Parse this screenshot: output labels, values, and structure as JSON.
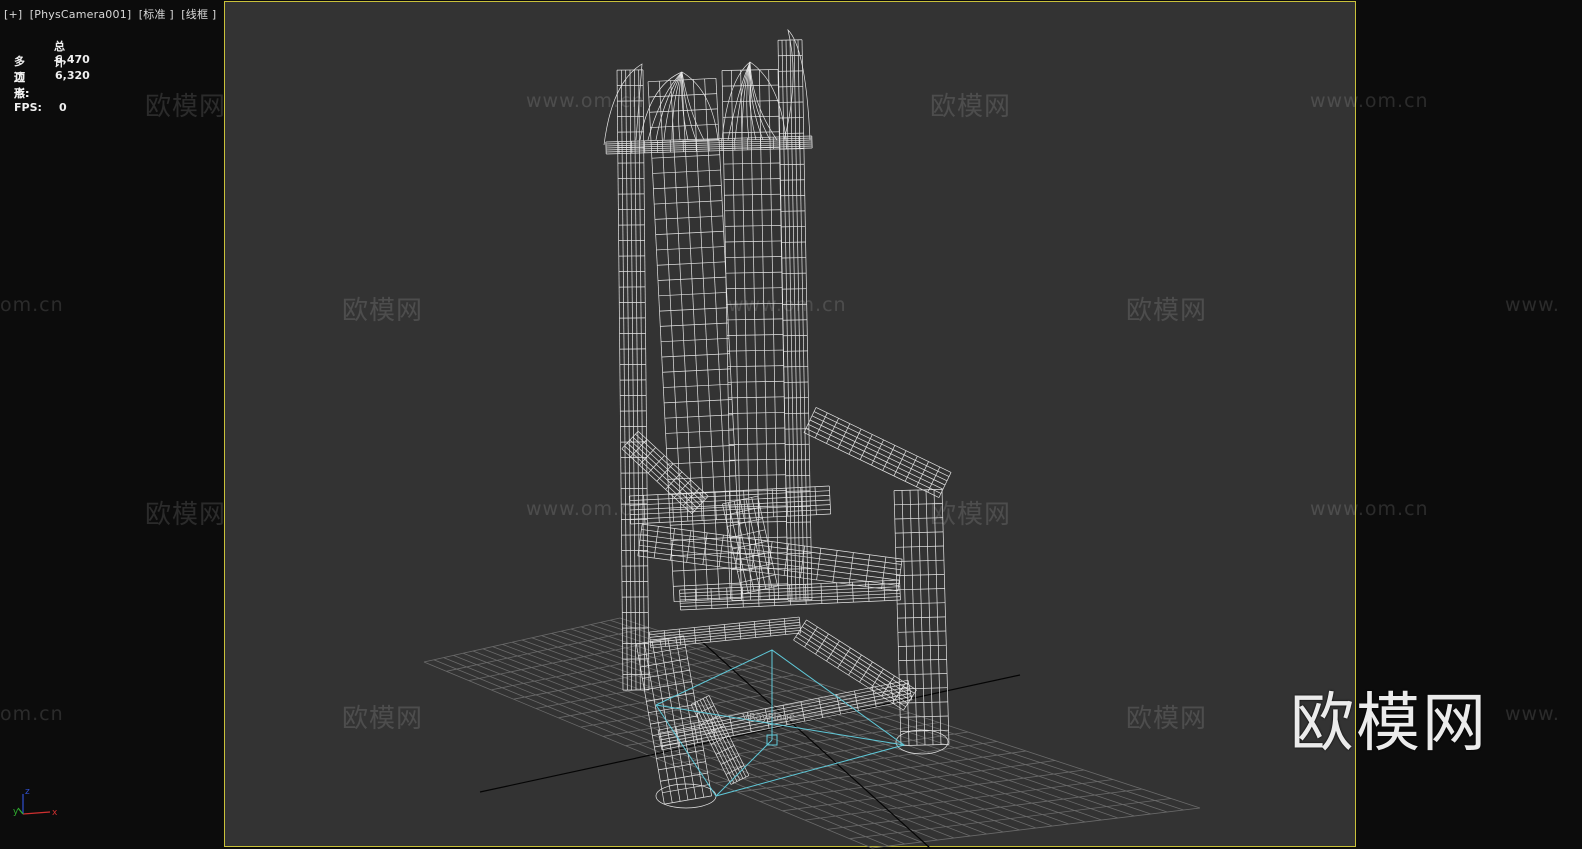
{
  "viewport": {
    "label": "[+]  [PhysCamera001]  [标准 ]  [线框 ]",
    "safe_frame_color": "#c9c13a",
    "background": "#333333"
  },
  "stats": {
    "header": "总计",
    "polygons_label": "多边形:",
    "polygons_value": "6,470",
    "vertices_label": "顶点:",
    "vertices_value": "6,320",
    "fps_label": "FPS:",
    "fps_value": "0"
  },
  "scene": {
    "object": "wireframe-throne-chair",
    "helper_label": "VRayPlane",
    "wire_color": "#e6e6e6",
    "helper_color": "#5fc8d8",
    "grid_color": "#6a6a6a"
  },
  "watermarks": {
    "cn": "欧模网",
    "url": "www.om.cn",
    "url_left": "om.cn",
    "url_right": "www.",
    "logo": "欧模网"
  },
  "gizmo": {
    "x": "x",
    "y": "y",
    "z": "z"
  }
}
